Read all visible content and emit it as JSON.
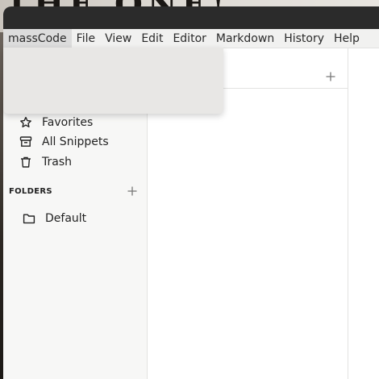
{
  "menubar": {
    "items": [
      "massCode",
      "File",
      "View",
      "Edit",
      "Editor",
      "Markdown",
      "History",
      "Help"
    ]
  },
  "sidebar": {
    "items": [
      {
        "label": "Favorites",
        "icon": "star-icon"
      },
      {
        "label": "All Snippets",
        "icon": "archive-icon"
      },
      {
        "label": "Trash",
        "icon": "trash-icon"
      }
    ],
    "folders_label": "FOLDERS",
    "folders": [
      {
        "label": "Default",
        "icon": "folder-icon"
      }
    ]
  },
  "colors": {
    "sidebar_bg": "#f7f7f6",
    "menubar_bg": "#f1f1f0",
    "dropdown_bg": "#e8e7e5"
  }
}
